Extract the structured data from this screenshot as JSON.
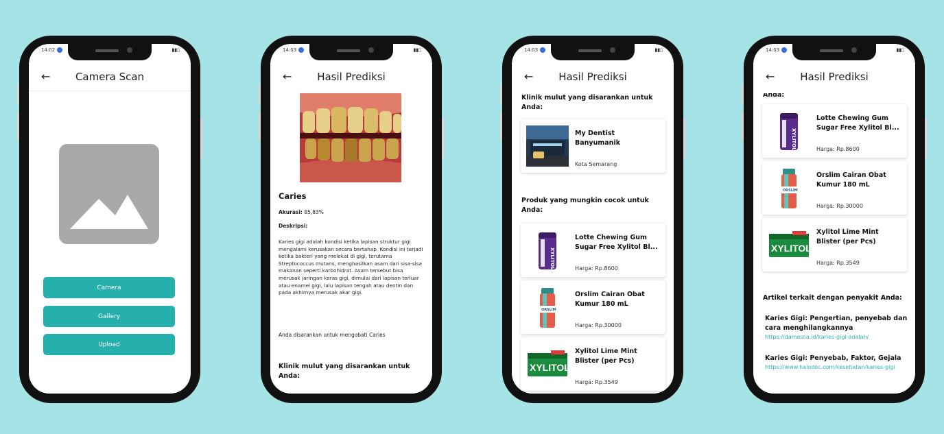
{
  "colors": {
    "background": "#a6e3e6",
    "accent": "#26b0ac",
    "link": "#2bb3b0"
  },
  "icons": {
    "back": "arrow-left-icon",
    "image": "image-placeholder-icon"
  },
  "phone1": {
    "time": "14:02",
    "title": "Camera Scan",
    "buttons": {
      "camera": "Camera",
      "gallery": "Gallery",
      "upload": "Upload"
    }
  },
  "phone2": {
    "time": "14:03",
    "title": "Hasil Prediksi",
    "disease": "Caries",
    "accuracy_label": "Akurasi:",
    "accuracy_value": "85,83%",
    "description_label": "Deskripsi:",
    "description": "Karies gigi adalah kondisi ketika lapisan struktur gigi mengalami kerusakan secara bertahap. Kondisi ini terjadi ketika bakteri yang melekat di gigi, terutama Streptococcus mutans, menghasilkan asam dari sisa-sisa makanan seperti karbohidrat. Asam tersebut bisa merusak jaringan keras gigi, dimulai dari lapisan terluar atau enamel gigi, lalu lapisan tengah atau dentin dan pada akhirnya merusak akar gigi.",
    "advice": "Anda disarankan untuk mengobati Caries",
    "clinic_section": "Klinik mulut yang disarankan untuk Anda:"
  },
  "phone3": {
    "time": "14:03",
    "title": "Hasil Prediksi",
    "clinic_section": "Klinik mulut yang disarankan untuk Anda:",
    "clinic": {
      "name": "My Dentist Banyumanik",
      "location": "Kota Semarang"
    },
    "product_section": "Produk yang mungkin cocok untuk Anda:",
    "products": [
      {
        "name": "Lotte Chewing Gum Sugar Free Xylitol Bl...",
        "price": "Harga: Rp.8600"
      },
      {
        "name": "Orslim Cairan Obat Kumur 180 mL",
        "price": "Harga: Rp.30000"
      },
      {
        "name": "Xylitol Lime Mint Blister (per Pcs)",
        "price": "Harga: Rp.3549"
      }
    ]
  },
  "phone4": {
    "time": "14:03",
    "title": "Hasil Prediksi",
    "section_tail": "Anda:",
    "products": [
      {
        "name": "Lotte Chewing Gum Sugar Free Xylitol Bl...",
        "price": "Harga: Rp.8600"
      },
      {
        "name": "Orslim Cairan Obat Kumur 180 mL",
        "price": "Harga: Rp.30000"
      },
      {
        "name": "Xylitol Lime Mint Blister (per Pcs)",
        "price": "Harga: Rp.3549"
      }
    ],
    "articles_section": "Artikel terkait dengan penyakit Anda:",
    "articles": [
      {
        "title": "Karies Gigi: Pengertian, penyebab dan cara menghilangkannya",
        "url": "https://damessa.id/karies-gigi-adalah/"
      },
      {
        "title": "Karies Gigi: Penyebab, Faktor, Gejala",
        "url": "https://www.halodoc.com/kesehatan/karies-gigi"
      }
    ]
  }
}
